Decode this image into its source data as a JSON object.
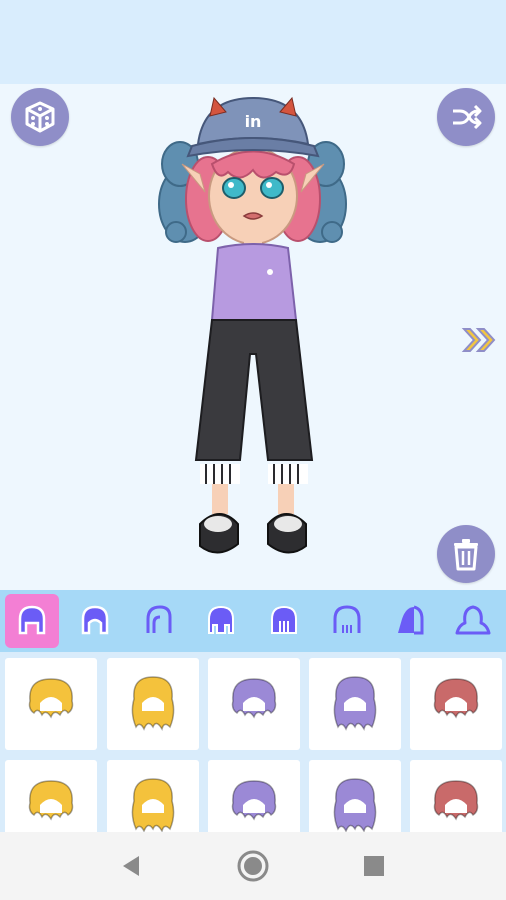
{
  "stage": {
    "hat_text": "in"
  },
  "buttons": {
    "random": "dice-icon",
    "shuffle": "shuffle-icon",
    "next": "double-chevron-right-icon",
    "delete": "trash-icon"
  },
  "tabs": [
    {
      "name": "hair-front-style-1",
      "active": true
    },
    {
      "name": "hair-front-style-2",
      "active": false
    },
    {
      "name": "hair-side-style",
      "active": false
    },
    {
      "name": "hair-bangs-style",
      "active": false
    },
    {
      "name": "hair-fringe-style",
      "active": false
    },
    {
      "name": "hair-back-style",
      "active": false
    },
    {
      "name": "hair-half-style",
      "active": false
    },
    {
      "name": "hair-bun-style",
      "active": false
    }
  ],
  "hair_items": [
    {
      "color": "#f4c23c"
    },
    {
      "color": "#f4c23c"
    },
    {
      "color": "#9b89d6"
    },
    {
      "color": "#9b89d6"
    },
    {
      "color": "#c96a6a"
    },
    {
      "color": "#f4c23c"
    },
    {
      "color": "#f4c23c"
    },
    {
      "color": "#9b89d6"
    },
    {
      "color": "#9b89d6"
    },
    {
      "color": "#c96a6a"
    }
  ],
  "colors": {
    "accent": "#8f8ec8",
    "tab_active": "#f37fd4",
    "tab_icon": "#6b5cf6"
  }
}
